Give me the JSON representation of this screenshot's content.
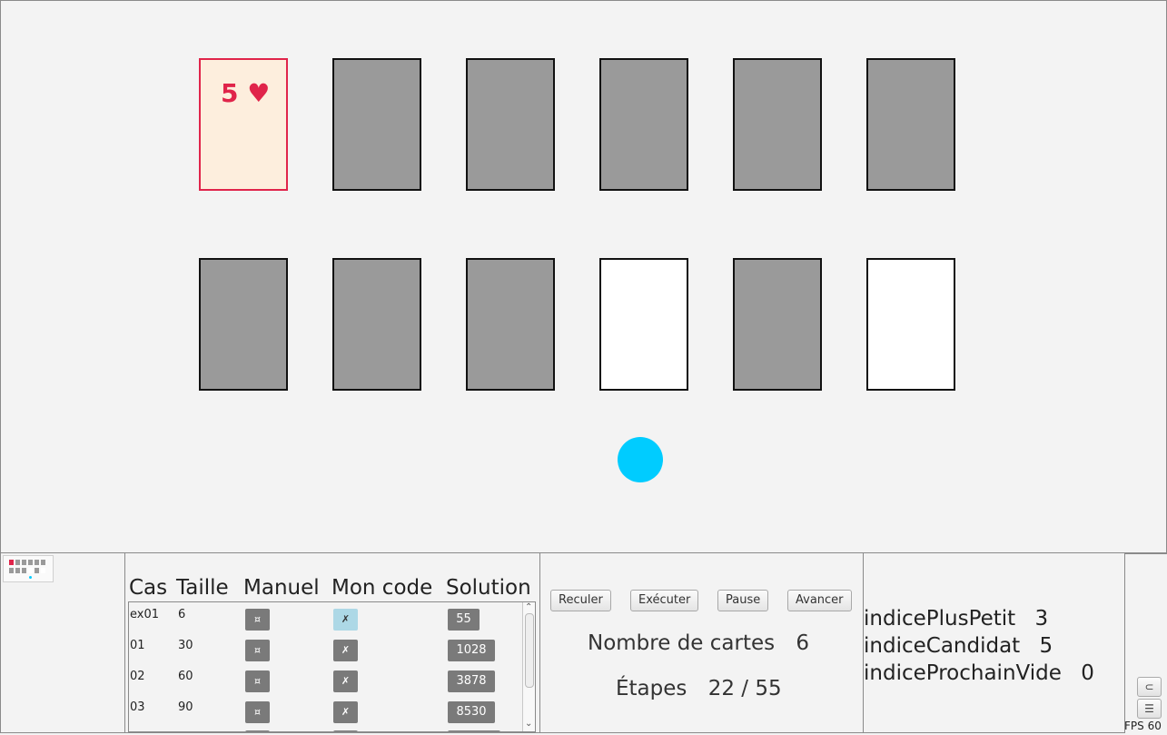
{
  "board": {
    "face_card": {
      "rank": "5",
      "suit": "♥"
    },
    "cards_row1": [
      "face",
      "back",
      "back",
      "back",
      "back",
      "back"
    ],
    "cards_row2": [
      "back",
      "back",
      "back",
      "empty",
      "back",
      "empty"
    ],
    "marker_color": "#00ccff"
  },
  "table": {
    "headers": [
      "Cas",
      "Taille",
      "Manuel",
      "Mon code",
      "Solution"
    ],
    "manual_glyph": "¤",
    "code_glyph": "✗",
    "rows": [
      {
        "cas": "ex01",
        "taille": "6",
        "solution": "55",
        "highlight": true
      },
      {
        "cas": "01",
        "taille": "30",
        "solution": "1028",
        "highlight": false
      },
      {
        "cas": "02",
        "taille": "60",
        "solution": "3878",
        "highlight": false
      },
      {
        "cas": "03",
        "taille": "90",
        "solution": "8530",
        "highlight": false
      }
    ]
  },
  "controls": {
    "reculer": "Reculer",
    "executer": "Exécuter",
    "pause": "Pause",
    "avancer": "Avancer"
  },
  "info": {
    "cards_label": "Nombre de cartes",
    "cards_value": "6",
    "steps_label": "Étapes",
    "steps_value": "22 / 55"
  },
  "variables": [
    {
      "name": "indicePlusPetit",
      "value": "3"
    },
    {
      "name": "indiceCandidat",
      "value": "5"
    },
    {
      "name": "indiceProchainVide",
      "value": "0"
    }
  ],
  "side": {
    "btn_top": "⊂",
    "btn_menu": "☰",
    "fps": "FPS 60"
  },
  "colors": {
    "card_back": "#9a9a9a",
    "card_face_bg": "#fdeedd",
    "heart_red": "#e0244a",
    "button_gray": "#7a7a7a",
    "highlight_blue": "#add8e6"
  }
}
